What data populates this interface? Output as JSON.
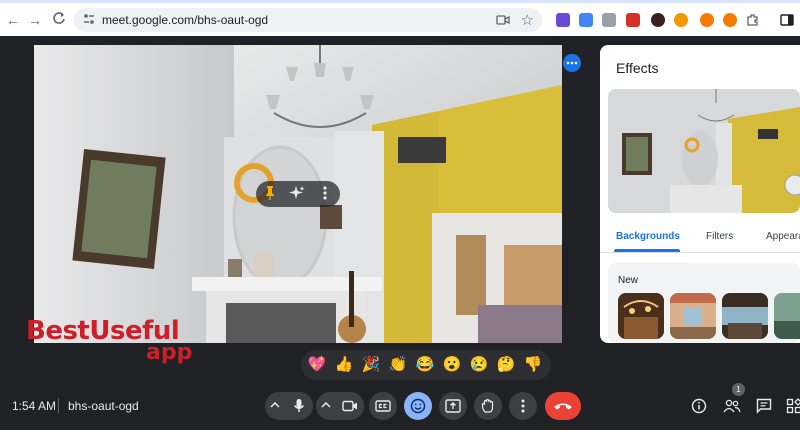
{
  "browser": {
    "url": "meet.google.com/bhs-oaut-ogd",
    "back_label": "←",
    "forward_label": "→",
    "reload_label": "C"
  },
  "tile_overlay": {
    "pin_icon": "pin-icon",
    "effects_icon": "sparkle-icon",
    "more_icon": "more-vert-icon"
  },
  "effects_panel": {
    "title": "Effects",
    "tabs": [
      {
        "label": "Backgrounds",
        "active": true
      },
      {
        "label": "Filters",
        "active": false
      },
      {
        "label": "Appeara",
        "active": false
      }
    ],
    "section_label": "New"
  },
  "watermark": {
    "line1": "BestUseful",
    "line2": "app"
  },
  "reactions": [
    "💖",
    "👍",
    "🎉",
    "👏",
    "😂",
    "😮",
    "😢",
    "🤔",
    "👎"
  ],
  "bottom_bar": {
    "time": "1:54 AM",
    "meeting_code": "bhs-oaut-ogd",
    "participant_count": "1"
  },
  "colors": {
    "meet_background": "#202124",
    "control_button": "#3c4043",
    "end_call": "#ea4335",
    "accent": "#1a73e8",
    "active_reaction_button": "#8ab4f8"
  }
}
